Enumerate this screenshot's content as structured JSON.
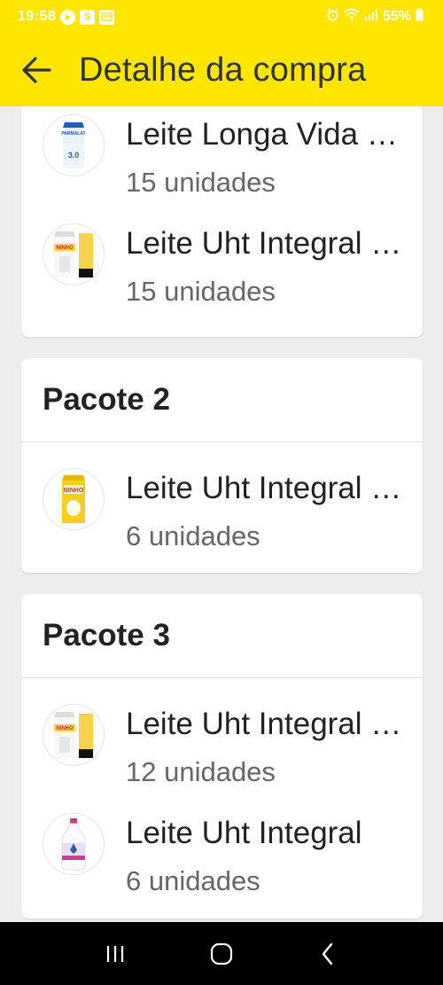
{
  "status_bar": {
    "time": "19:58",
    "app_icon_s": "S",
    "battery_percent": "55%"
  },
  "header": {
    "title": "Detalhe da compra"
  },
  "packages": [
    {
      "title": "",
      "items": [
        {
          "name": "Leite Longa Vida Parmalat",
          "quantity": "15 unidades",
          "icon": "milk-carton-blue",
          "badge": "3.0"
        },
        {
          "name": "Leite Uht Integral Ninho",
          "quantity": "15 unidades",
          "icon": "milk-carton-yellow-white",
          "badge": "NINHO"
        }
      ]
    },
    {
      "title": "Pacote 2",
      "items": [
        {
          "name": "Leite Uht Integral Ninho",
          "quantity": "6 unidades",
          "icon": "milk-carton-yellow",
          "badge": "NINHO"
        }
      ]
    },
    {
      "title": "Pacote 3",
      "items": [
        {
          "name": "Leite Uht Integral Ninho",
          "quantity": "12 unidades",
          "icon": "milk-carton-yellow-white",
          "badge": "NINHO"
        },
        {
          "name": "Leite Uht Integral",
          "quantity": "6 unidades",
          "icon": "milk-bottle-pink",
          "badge": ""
        }
      ]
    }
  ],
  "colors": {
    "accent": "#ffe600",
    "background": "#ededed",
    "card": "#ffffff",
    "text": "#222222",
    "subtext": "#666666"
  }
}
